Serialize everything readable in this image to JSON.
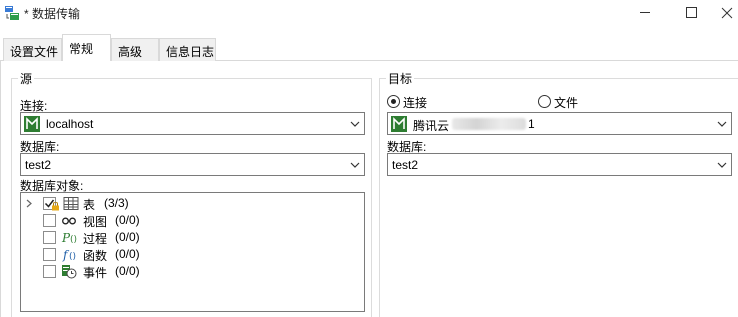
{
  "window": {
    "title": "* 数据传输",
    "icons": {
      "app": "data-transfer-icon",
      "minimize": "minimize-icon",
      "maximize": "maximize-icon",
      "close": "close-icon"
    }
  },
  "tabs": [
    {
      "label": "设置文件",
      "active": false
    },
    {
      "label": "常规",
      "active": true
    },
    {
      "label": "高级",
      "active": false
    },
    {
      "label": "信息日志",
      "active": false
    }
  ],
  "source": {
    "legend": "源",
    "connection_label": "连接:",
    "connection_value": "localhost",
    "database_label": "数据库:",
    "database_value": "test2",
    "objects_label": "数据库对象:",
    "tree": [
      {
        "label": "表",
        "count": "(3/3)",
        "icon": "table-icon",
        "checked": true,
        "expandable": true
      },
      {
        "label": "视图",
        "count": "(0/0)",
        "icon": "view-glasses-icon",
        "checked": false
      },
      {
        "label": "过程",
        "count": "(0/0)",
        "icon": "procedure-icon",
        "checked": false
      },
      {
        "label": "函数",
        "count": "(0/0)",
        "icon": "function-icon",
        "checked": false
      },
      {
        "label": "事件",
        "count": "(0/0)",
        "icon": "event-clock-icon",
        "checked": false
      }
    ]
  },
  "target": {
    "legend": "目标",
    "mode_connection_label": "连接",
    "mode_file_label": "文件",
    "selected_mode": "连接",
    "connection_value": "腾讯云",
    "connection_value_suffix": "1",
    "database_label": "数据库:",
    "database_value": "test2"
  },
  "colors": {
    "mysql_green": "#2e7d32",
    "border": "#7a7a7a",
    "tab_bg": "#f0f0f0"
  }
}
